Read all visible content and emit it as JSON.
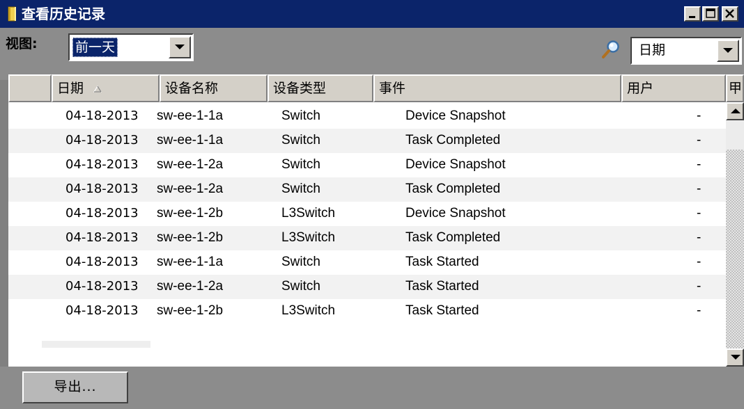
{
  "window": {
    "title": "查看历史记录",
    "icon": "notebook-icon",
    "controls": [
      "minimize-icon",
      "maximize-icon",
      "close-icon"
    ]
  },
  "toolbar": {
    "view_label": "视图:",
    "view_select": "前一天",
    "search_icon": "magnifier-icon",
    "filter_select": "日期"
  },
  "grid": {
    "columns": [
      "日期",
      "设备名称",
      "设备类型",
      "事件",
      "用户",
      "甲"
    ],
    "sort_column": "日期",
    "sort_direction": "ascending",
    "rows": [
      {
        "date": "04-18-2013",
        "device": "sw-ee-1-1a",
        "type": "Switch",
        "event": "Device Snapshot",
        "user": "-"
      },
      {
        "date": "04-18-2013",
        "device": "sw-ee-1-1a",
        "type": "Switch",
        "event": "Task Completed",
        "user": "-"
      },
      {
        "date": "04-18-2013",
        "device": "sw-ee-1-2a",
        "type": "Switch",
        "event": "Device Snapshot",
        "user": "-"
      },
      {
        "date": "04-18-2013",
        "device": "sw-ee-1-2a",
        "type": "Switch",
        "event": "Task Completed",
        "user": "-"
      },
      {
        "date": "04-18-2013",
        "device": "sw-ee-1-2b",
        "type": "L3Switch",
        "event": "Device Snapshot",
        "user": "-"
      },
      {
        "date": "04-18-2013",
        "device": "sw-ee-1-2b",
        "type": "L3Switch",
        "event": "Task Completed",
        "user": "-"
      },
      {
        "date": "04-18-2013",
        "device": "sw-ee-1-1a",
        "type": "Switch",
        "event": "Task Started",
        "user": "-"
      },
      {
        "date": "04-18-2013",
        "device": "sw-ee-1-2a",
        "type": "Switch",
        "event": "Task Started",
        "user": "-"
      },
      {
        "date": "04-18-2013",
        "device": "sw-ee-1-2b",
        "type": "L3Switch",
        "event": "Task Started",
        "user": "-"
      }
    ]
  },
  "footer": {
    "export_label": "导出..."
  },
  "colors": {
    "title_bar": "#0b246a",
    "chrome": "#d4d0c8",
    "background": "#8c8c8c",
    "selection": "#0a246a",
    "row_alt": "#f2f2f2"
  }
}
